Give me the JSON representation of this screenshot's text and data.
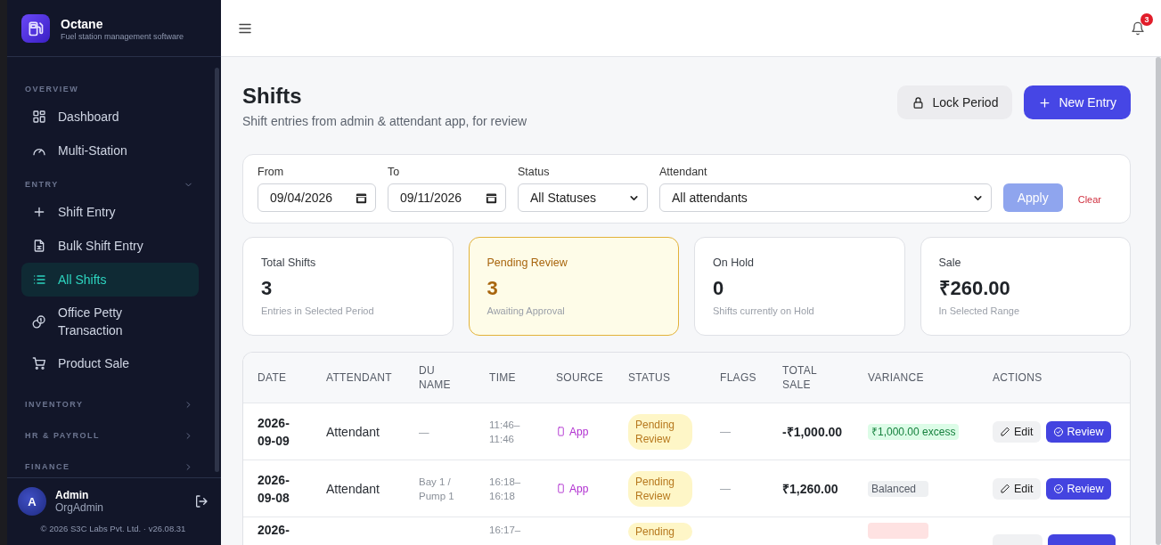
{
  "sidebar": {
    "brand": {
      "name": "Octane",
      "tagline": "Fuel station management software"
    },
    "sections": [
      {
        "title": "OVERVIEW",
        "items": [
          {
            "label": "Dashboard",
            "selected": false
          },
          {
            "label": "Multi-Station",
            "selected": false
          }
        ]
      },
      {
        "title": "ENTRY",
        "expanded": true,
        "items": [
          {
            "label": "Shift Entry",
            "selected": false
          },
          {
            "label": "Bulk Shift Entry",
            "selected": false
          },
          {
            "label": "All Shifts",
            "selected": true
          },
          {
            "label": "Office Petty Transaction",
            "selected": false
          },
          {
            "label": "Product Sale",
            "selected": false
          }
        ]
      },
      {
        "title": "INVENTORY",
        "expanded": false
      },
      {
        "title": "HR & PAYROLL",
        "expanded": false
      },
      {
        "title": "FINANCE",
        "expanded": false
      }
    ],
    "user": {
      "initial": "A",
      "name": "Admin",
      "role": "OrgAdmin"
    },
    "footer": "© 2026 S3C Labs Pvt. Ltd. · v26.08.31"
  },
  "topbar": {
    "notification_count": "3"
  },
  "page": {
    "title": "Shifts",
    "subtitle": "Shift entries from admin & attendant app, for review",
    "actions": [
      {
        "label": "Lock Period",
        "kind": "secondary"
      },
      {
        "label": "New Entry",
        "kind": "primary"
      }
    ]
  },
  "filters": {
    "fields": [
      {
        "label": "From",
        "kind": "date",
        "value": "09/04/2026"
      },
      {
        "label": "To",
        "kind": "date",
        "value": "09/11/2026"
      },
      {
        "label": "Status",
        "kind": "select",
        "value": "All Statuses"
      },
      {
        "label": "Attendant",
        "kind": "select",
        "value": "All attendants"
      }
    ],
    "apply": {
      "label": "Apply",
      "disabled": true
    },
    "clear": "Clear"
  },
  "stats": [
    {
      "label": "Total Shifts",
      "value": "3",
      "note": "Entries in Selected Period",
      "highlighted": false
    },
    {
      "label": "Pending Review",
      "value": "3",
      "note": "Awaiting Approval",
      "highlighted": true
    },
    {
      "label": "On Hold",
      "value": "0",
      "note": "Shifts currently on Hold",
      "highlighted": false
    },
    {
      "label": "Sale",
      "value": "₹260.00",
      "note": "In Selected Range",
      "highlighted": false
    }
  ],
  "table": {
    "columns": [
      "DATE",
      "ATTENDANT",
      "DU NAME",
      "TIME",
      "SOURCE",
      "STATUS",
      "FLAGS",
      "TOTAL SALE",
      "VARIANCE",
      "ACTIONS"
    ],
    "rows": [
      {
        "date": "2026-09-09",
        "attendant": "Attendant",
        "du_name": "—",
        "time": "11:46–11:46",
        "source": "App",
        "status": "Pending Review",
        "flags": "—",
        "total_sale": "-₹1,000.00",
        "variance": {
          "label": "₹1,000.00 excess",
          "kind": "positive"
        },
        "actions": [
          {
            "label": "Edit",
            "kind": "secondary"
          },
          {
            "label": "Review",
            "kind": "primary"
          }
        ]
      },
      {
        "date": "2026-09-08",
        "attendant": "Attendant",
        "du_name": "Bay 1 / Pump 1",
        "time": "16:18–16:18",
        "source": "App",
        "status": "Pending Review",
        "flags": "—",
        "total_sale": "₹1,260.00",
        "variance": {
          "label": "Balanced",
          "kind": "neutral"
        },
        "actions": [
          {
            "label": "Edit",
            "kind": "secondary"
          },
          {
            "label": "Review",
            "kind": "primary"
          }
        ]
      },
      {
        "date": "2026-",
        "time": "16:17–",
        "status": "Pending",
        "variance": {
          "kind": "negative"
        },
        "actions": [
          {
            "kind": "secondary"
          },
          {
            "kind": "primary"
          }
        ]
      }
    ]
  }
}
